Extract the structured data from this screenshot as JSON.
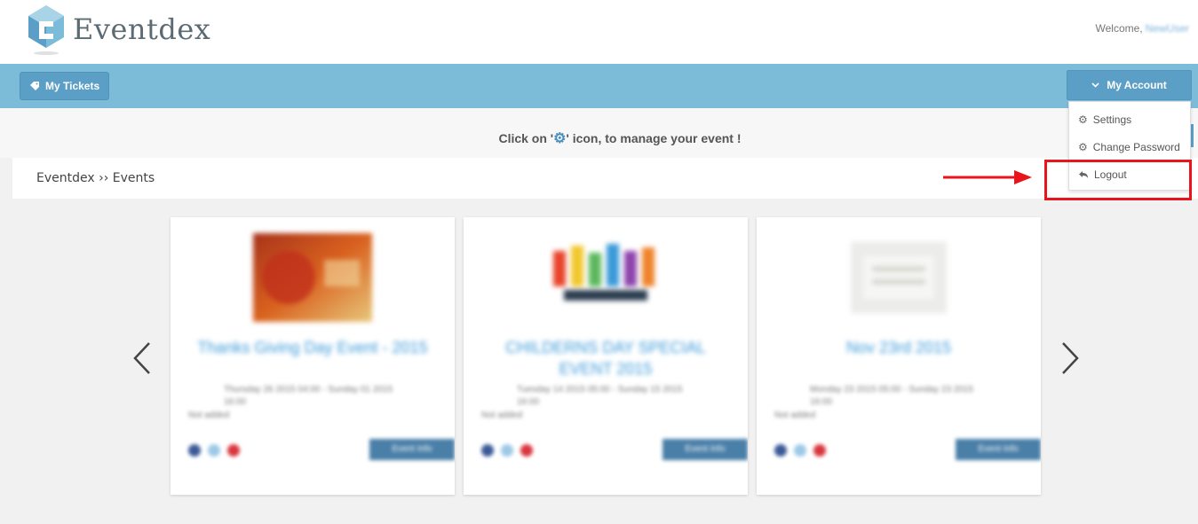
{
  "header": {
    "brand": "Eventdex",
    "welcome_label": "Welcome,",
    "username": "NewUser"
  },
  "nav": {
    "my_tickets": "My Tickets",
    "my_account": "My Account"
  },
  "account_menu": {
    "settings": "Settings",
    "change_password": "Change Password",
    "logout": "Logout"
  },
  "notice": {
    "before": "Click on '",
    "after": "' icon, to manage your event !"
  },
  "breadcrumb": "Eventdex ›› Events",
  "events": [
    {
      "title": "Thanks Giving Day Event - 2015",
      "meta": "Thursday 26 2015 04:00 - Sunday 01 2015 16:00",
      "location": "Not added",
      "action": "Event Info"
    },
    {
      "title": "CHILDERNS DAY SPECIAL EVENT 2015",
      "meta": "Tuesday 14 2015 05:00 - Sunday 15 2015 16:00",
      "location": "Not added",
      "action": "Event Info"
    },
    {
      "title": "Nov 23rd 2015",
      "meta": "Monday 23 2015 05:00 - Sunday 23 2015 16:00",
      "location": "Not added",
      "action": "Event Info"
    }
  ],
  "colors": {
    "navbar": "#7dbcd9",
    "button": "#5b9fc7",
    "highlight": "#e8161c",
    "event_title": "#3b9ad9"
  }
}
